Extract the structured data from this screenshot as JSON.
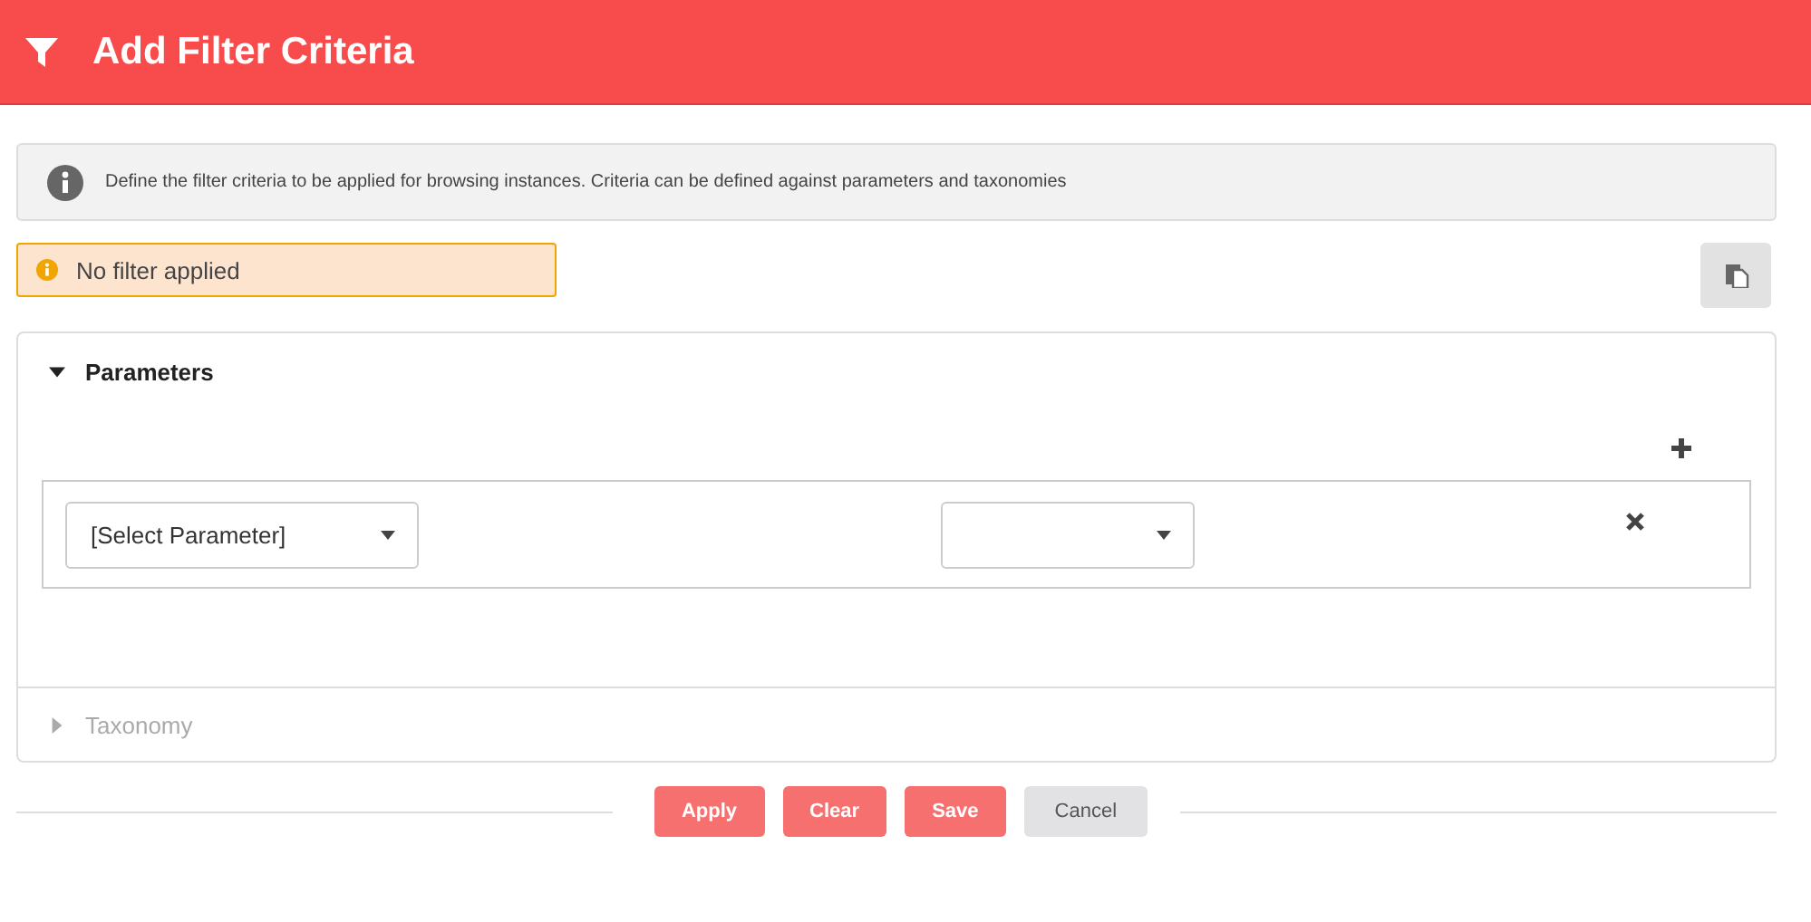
{
  "header": {
    "title": "Add Filter Criteria"
  },
  "info": {
    "text": "Define the filter criteria to be applied for browsing instances. Criteria can be defined against parameters and taxonomies"
  },
  "status": {
    "text": "No filter applied"
  },
  "sections": [
    {
      "title": "Parameters",
      "expanded": true,
      "rows": [
        {
          "parameter": {
            "placeholder": "[Select Parameter]"
          },
          "operator": {}
        }
      ]
    },
    {
      "title": "Taxonomy",
      "expanded": false
    }
  ],
  "buttons": [
    {
      "label": "Apply",
      "kind": "primary"
    },
    {
      "label": "Clear",
      "kind": "primary"
    },
    {
      "label": "Save",
      "kind": "primary"
    },
    {
      "label": "Cancel",
      "kind": "secondary"
    }
  ]
}
